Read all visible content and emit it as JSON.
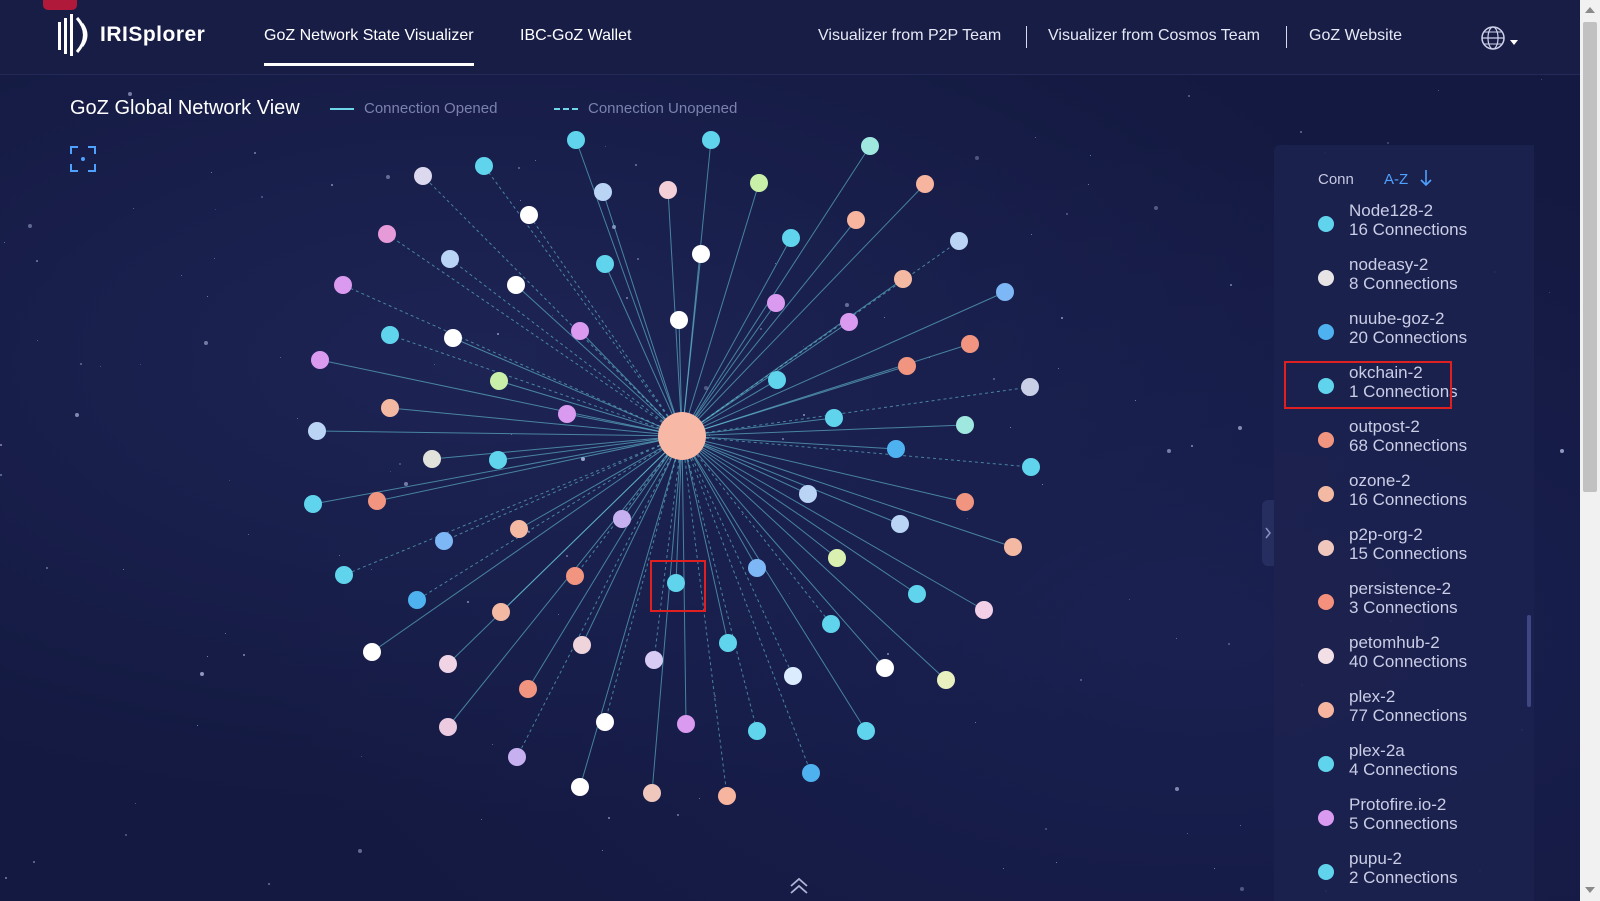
{
  "header": {
    "logo_text": "IRISplorer",
    "tabs": [
      {
        "label": "GoZ Network State Visualizer",
        "active": true
      },
      {
        "label": "IBC-GoZ Wallet",
        "active": false
      }
    ],
    "links": [
      {
        "label": "Visualizer from P2P Team"
      },
      {
        "label": "Visualizer from Cosmos Team"
      },
      {
        "label": "GoZ Website"
      }
    ],
    "language_icon": "globe-icon"
  },
  "view": {
    "title": "GoZ Global Network View",
    "legend_opened": "Connection Opened",
    "legend_unopened": "Connection Unopened",
    "fullscreen_icon": "fullscreen-icon"
  },
  "colors": {
    "background": "#131940",
    "link": "#6fd6e8",
    "hub": "#f7b8a5",
    "highlight": "#e02020",
    "accent": "#4ea1ff"
  },
  "graph": {
    "hub": {
      "name": "",
      "color": "#f7b8a5"
    },
    "highlighted_node": "okchain-2"
  },
  "panel": {
    "tab_conn": "Conn",
    "tab_az": "A-Z",
    "sort_icon": "arrow-down-icon",
    "nodes": [
      {
        "name": "Node128-2",
        "count": "16 Connections",
        "color": "#5fd4ec"
      },
      {
        "name": "nodeasy-2",
        "count": "8 Connections",
        "color": "#e8e4e6"
      },
      {
        "name": "nuube-goz-2",
        "count": "20 Connections",
        "color": "#4fb2f0"
      },
      {
        "name": "okchain-2",
        "count": "1 Connections",
        "color": "#5fd4ec",
        "highlighted": true
      },
      {
        "name": "outpost-2",
        "count": "68 Connections",
        "color": "#f29580"
      },
      {
        "name": "ozone-2",
        "count": "16 Connections",
        "color": "#f4b9a2"
      },
      {
        "name": "p2p-org-2",
        "count": "15 Connections",
        "color": "#f0c7bd"
      },
      {
        "name": "persistence-2",
        "count": "3 Connections",
        "color": "#f5907c"
      },
      {
        "name": "petomhub-2",
        "count": "40 Connections",
        "color": "#f3e0e6"
      },
      {
        "name": "plex-2",
        "count": "77 Connections",
        "color": "#f7b49e"
      },
      {
        "name": "plex-2a",
        "count": "4 Connections",
        "color": "#5fd4ec"
      },
      {
        "name": "Protofire.io-2",
        "count": "5 Connections",
        "color": "#d99af0"
      },
      {
        "name": "pupu-2",
        "count": "2 Connections",
        "color": "#5fd4ec"
      }
    ]
  }
}
